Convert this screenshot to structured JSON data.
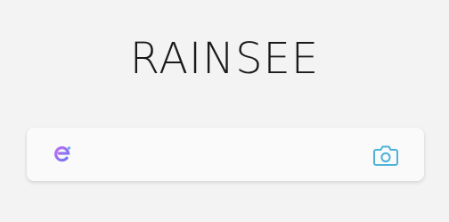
{
  "logo": {
    "text": "RAINSEE"
  },
  "search": {
    "placeholder": "",
    "value": "",
    "engine_icon": "search-engine-icon",
    "camera_icon": "camera-icon"
  },
  "colors": {
    "background": "#f3f3f3",
    "search_bar": "#fafafa",
    "engine_icon_gradient_start": "#c06cf0",
    "engine_icon_gradient_end": "#6a7cf4",
    "camera_icon": "#4fb3d9"
  }
}
